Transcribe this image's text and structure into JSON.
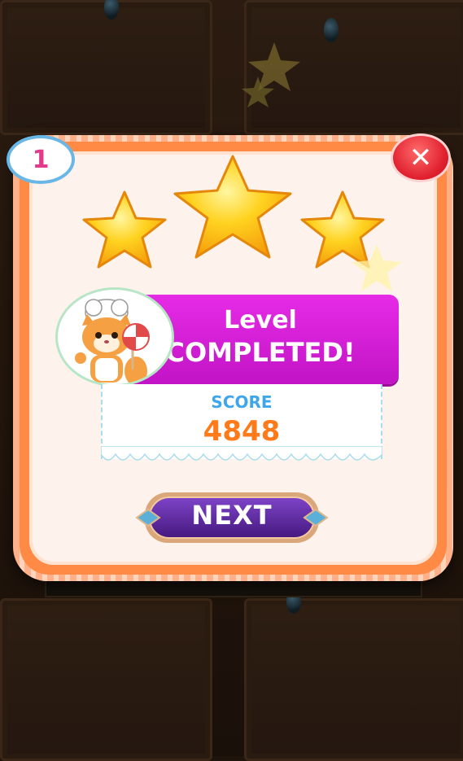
{
  "level_badge": {
    "number": "1"
  },
  "close_button": {
    "label": "✕"
  },
  "stars": {
    "earned": 3,
    "total": 3
  },
  "banner": {
    "line1": "Level",
    "line2": "COMPLETED!"
  },
  "score": {
    "label": "SCORE",
    "value": "4848"
  },
  "next_button": {
    "label": "NEXT"
  },
  "colors": {
    "banner": "#d01fd3",
    "score_label": "#3ea6ea",
    "score_value": "#ff7a1a",
    "panel_border": "#ff8a45",
    "button": "#5b2aa0"
  },
  "icons": [
    "star-icon",
    "close-icon",
    "mascot-chef-cat",
    "lollipop-icon"
  ]
}
